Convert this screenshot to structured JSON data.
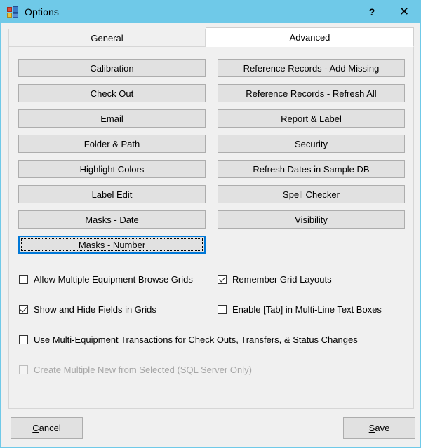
{
  "window": {
    "title": "Options",
    "icon": "form-icon",
    "titlebar_color": "#6FC9E8",
    "help_button": "?",
    "close_button": "✕"
  },
  "tabs": [
    {
      "label": "General",
      "active": false
    },
    {
      "label": "Advanced",
      "active": true
    }
  ],
  "buttons": {
    "left_column": [
      "Calibration",
      "Check Out",
      "Email",
      "Folder & Path",
      "Highlight Colors",
      "Label Edit",
      "Masks - Date",
      "Masks - Number"
    ],
    "right_column": [
      "Reference Records - Add Missing",
      "Reference Records - Refresh All",
      "Report & Label",
      "Security",
      "Refresh Dates in Sample DB",
      "Spell Checker",
      "Visibility"
    ],
    "focused": "Masks - Number",
    "focus_color": "#0078D7"
  },
  "checkboxes": [
    {
      "label": "Allow Multiple Equipment Browse Grids",
      "checked": false,
      "disabled": false
    },
    {
      "label": "Remember Grid Layouts",
      "checked": true,
      "disabled": false
    },
    {
      "label": "Show and Hide Fields in Grids",
      "checked": true,
      "disabled": false
    },
    {
      "label": "Enable [Tab] in Multi-Line Text Boxes",
      "checked": false,
      "disabled": false
    },
    {
      "label": "Use Multi-Equipment Transactions for Check Outs, Transfers, & Status Changes",
      "checked": false,
      "disabled": false
    },
    {
      "label": "Create Multiple New from Selected (SQL Server Only)",
      "checked": false,
      "disabled": true
    }
  ],
  "footer": {
    "cancel": {
      "accel": "C",
      "rest": "ancel"
    },
    "save": {
      "accel": "S",
      "rest": "ave"
    }
  }
}
